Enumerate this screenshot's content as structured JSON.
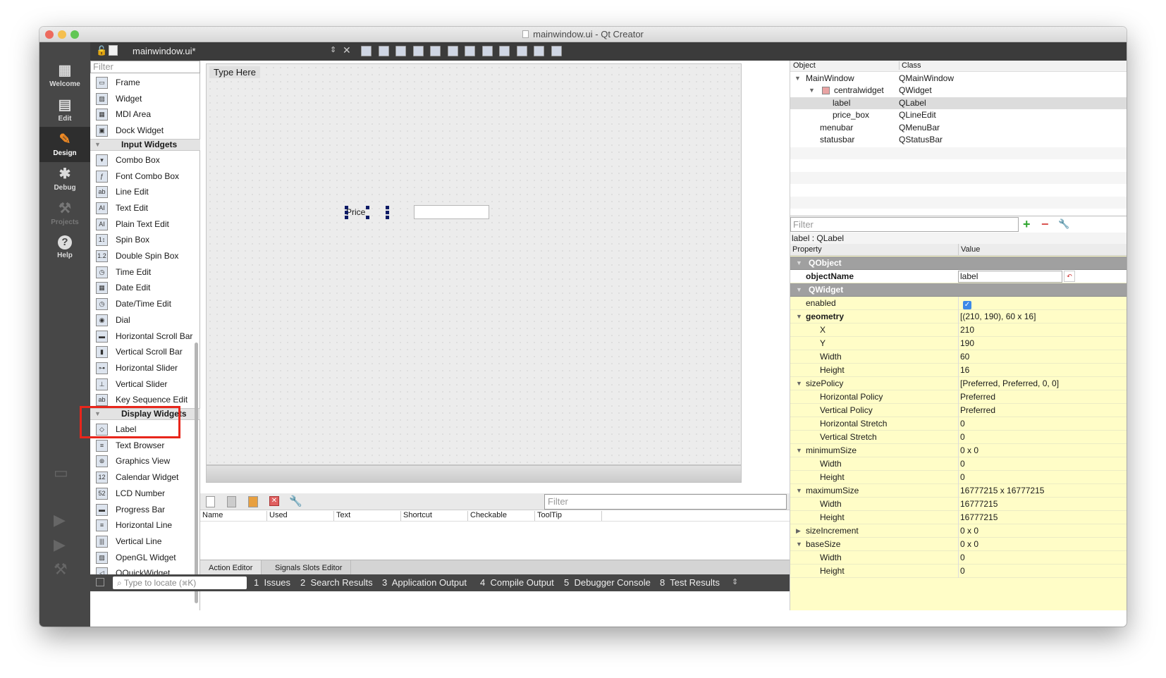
{
  "window": {
    "title": "mainwindow.ui - Qt Creator",
    "colors": {
      "close": "#ed6a5e",
      "min": "#f5bf4f",
      "max": "#62c655"
    }
  },
  "modes": [
    {
      "label": "Welcome",
      "icon": "grid-icon"
    },
    {
      "label": "Edit",
      "icon": "document-icon"
    },
    {
      "label": "Design",
      "icon": "pencil-icon"
    },
    {
      "label": "Debug",
      "icon": "bug-icon"
    },
    {
      "label": "Projects",
      "icon": "wrench-icon"
    },
    {
      "label": "Help",
      "icon": "help-icon"
    }
  ],
  "doc": {
    "name": "mainwindow.ui*"
  },
  "palette": {
    "filter_placeholder": "Filter",
    "items": [
      {
        "label": "Frame"
      },
      {
        "label": "Widget"
      },
      {
        "label": "MDI Area"
      },
      {
        "label": "Dock Widget"
      },
      {
        "category": "Input Widgets"
      },
      {
        "label": "Combo Box"
      },
      {
        "label": "Font Combo Box"
      },
      {
        "label": "Line Edit"
      },
      {
        "label": "Text Edit"
      },
      {
        "label": "Plain Text Edit"
      },
      {
        "label": "Spin Box"
      },
      {
        "label": "Double Spin Box"
      },
      {
        "label": "Time Edit"
      },
      {
        "label": "Date Edit"
      },
      {
        "label": "Date/Time Edit"
      },
      {
        "label": "Dial"
      },
      {
        "label": "Horizontal Scroll Bar"
      },
      {
        "label": "Vertical Scroll Bar"
      },
      {
        "label": "Horizontal Slider"
      },
      {
        "label": "Vertical Slider"
      },
      {
        "label": "Key Sequence Edit"
      },
      {
        "category": "Display Widgets"
      },
      {
        "label": "Label"
      },
      {
        "label": "Text Browser"
      },
      {
        "label": "Graphics View"
      },
      {
        "label": "Calendar Widget"
      },
      {
        "label": "LCD Number"
      },
      {
        "label": "Progress Bar"
      },
      {
        "label": "Horizontal Line"
      },
      {
        "label": "Vertical Line"
      },
      {
        "label": "OpenGL Widget"
      },
      {
        "label": "QQuickWidget"
      }
    ]
  },
  "form": {
    "menu_placeholder": "Type Here",
    "label_text": "Price"
  },
  "action_editor": {
    "filter_placeholder": "Filter",
    "columns": [
      "Name",
      "Used",
      "Text",
      "Shortcut",
      "Checkable",
      "ToolTip"
    ],
    "tabs": [
      "Action Editor",
      "Signals Slots Editor"
    ]
  },
  "bottom": {
    "locate_placeholder": "Type to locate (⌘K)",
    "tabs": [
      "1  Issues",
      "2  Search Results",
      "3  Application Output",
      "4  Compile Output",
      "5  Debugger Console",
      "8  Test Results"
    ]
  },
  "object_inspector": {
    "headers": [
      "Object",
      "Class"
    ],
    "rows": [
      {
        "object": "MainWindow",
        "class": "QMainWindow"
      },
      {
        "object": "centralwidget",
        "class": "QWidget"
      },
      {
        "object": "label",
        "class": "QLabel"
      },
      {
        "object": "price_box",
        "class": "QLineEdit"
      },
      {
        "object": "menubar",
        "class": "QMenuBar"
      },
      {
        "object": "statusbar",
        "class": "QStatusBar"
      }
    ]
  },
  "property_editor": {
    "filter_placeholder": "Filter",
    "title": "label : QLabel",
    "headers": [
      "Property",
      "Value"
    ],
    "rows": [
      {
        "name": "QObject",
        "value": "",
        "type": "group"
      },
      {
        "name": "objectName",
        "value": "label",
        "type": "bold-white"
      },
      {
        "name": "QWidget",
        "value": "",
        "type": "group"
      },
      {
        "name": "enabled",
        "value": "",
        "type": "check"
      },
      {
        "name": "geometry",
        "value": "[(210, 190), 60 x 16]",
        "type": "bold"
      },
      {
        "name": "X",
        "value": "210",
        "type": "sub"
      },
      {
        "name": "Y",
        "value": "190",
        "type": "sub"
      },
      {
        "name": "Width",
        "value": "60",
        "type": "sub"
      },
      {
        "name": "Height",
        "value": "16",
        "type": "sub"
      },
      {
        "name": "sizePolicy",
        "value": "[Preferred, Preferred, 0, 0]",
        "type": "expand"
      },
      {
        "name": "Horizontal Policy",
        "value": "Preferred",
        "type": "sub"
      },
      {
        "name": "Vertical Policy",
        "value": "Preferred",
        "type": "sub"
      },
      {
        "name": "Horizontal Stretch",
        "value": "0",
        "type": "sub"
      },
      {
        "name": "Vertical Stretch",
        "value": "0",
        "type": "sub"
      },
      {
        "name": "minimumSize",
        "value": "0 x 0",
        "type": "expand"
      },
      {
        "name": "Width",
        "value": "0",
        "type": "sub"
      },
      {
        "name": "Height",
        "value": "0",
        "type": "sub"
      },
      {
        "name": "maximumSize",
        "value": "16777215 x 16777215",
        "type": "expand"
      },
      {
        "name": "Width",
        "value": "16777215",
        "type": "sub"
      },
      {
        "name": "Height",
        "value": "16777215",
        "type": "sub"
      },
      {
        "name": "sizeIncrement",
        "value": "0 x 0",
        "type": "collapsed"
      },
      {
        "name": "baseSize",
        "value": "0 x 0",
        "type": "expand"
      },
      {
        "name": "Width",
        "value": "0",
        "type": "sub"
      },
      {
        "name": "Height",
        "value": "0",
        "type": "sub"
      }
    ]
  }
}
